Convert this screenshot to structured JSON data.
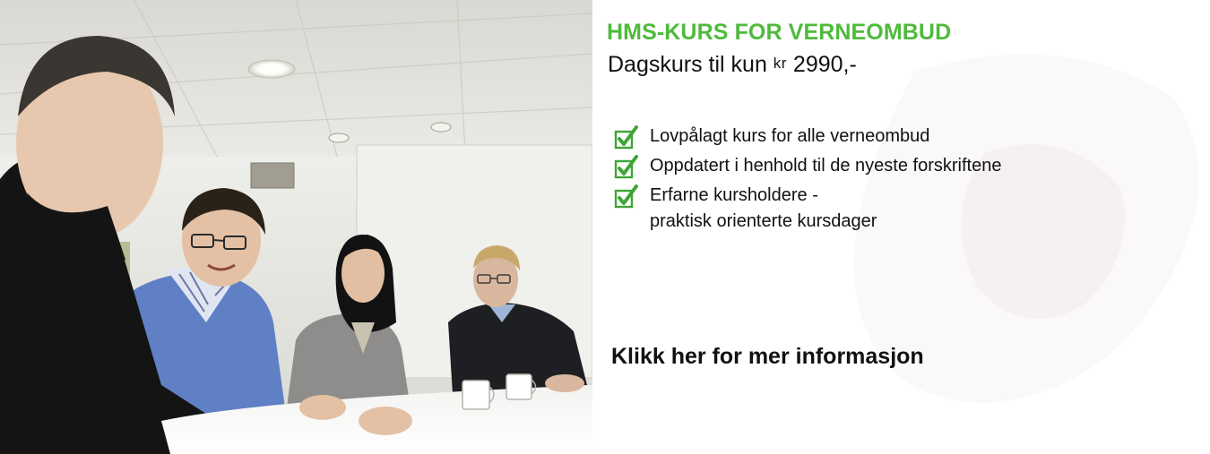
{
  "ad": {
    "headline": "HMS-KURS FOR VERNEOMBUD",
    "subline_prefix": "Dagskurs til kun ",
    "currency": "kr",
    "price": " 2990,-",
    "benefits": [
      {
        "line1": "Lovpålagt kurs for alle verneombud",
        "line2": ""
      },
      {
        "line1": "Oppdatert i henhold til de nyeste forskriftene",
        "line2": ""
      },
      {
        "line1": "Erfarne kursholdere -",
        "line2": "praktisk orienterte kursdager"
      }
    ],
    "cta_label": "Klikk her for mer informasjon"
  },
  "colors": {
    "accent_green": "#4fba3c",
    "text": "#111111",
    "checkmark": "#3fa535"
  },
  "icons": {
    "benefit_marker": "checkbox-check-icon"
  }
}
